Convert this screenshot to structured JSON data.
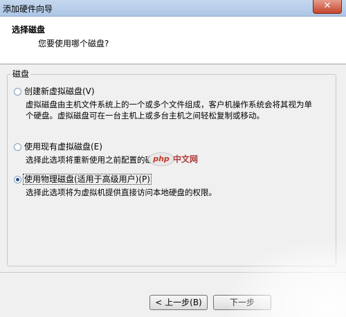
{
  "window": {
    "title": "添加硬件向导",
    "close_glyph": "✕"
  },
  "header": {
    "title": "选择磁盘",
    "subtitle": "您要使用哪个磁盘?"
  },
  "group": {
    "label": "磁盘"
  },
  "options": [
    {
      "label": "创建新虚拟磁盘(V)",
      "checked": false,
      "desc_lines": [
        "虚拟磁盘由主机文件系统上的一个或多个文件组成，客户机操作系统会将其视为单",
        "个硬盘。虚拟磁盘可在一台主机上或多台主机之间轻松复制或移动。"
      ]
    },
    {
      "label": "使用现有虚拟磁盘(E)",
      "checked": false,
      "desc_lines": [
        "选择此选项将重新使用之前配置的磁盘。"
      ]
    },
    {
      "label": "使用物理磁盘(适用于高级用户)(P)",
      "checked": true,
      "desc_lines": [
        "选择此选项将为虚拟机提供直接访问本地硬盘的权限。"
      ]
    }
  ],
  "watermark": {
    "badge": "php",
    "text": "中文网"
  },
  "buttons": {
    "back": "< 上一步(B)",
    "next": "下一步"
  }
}
